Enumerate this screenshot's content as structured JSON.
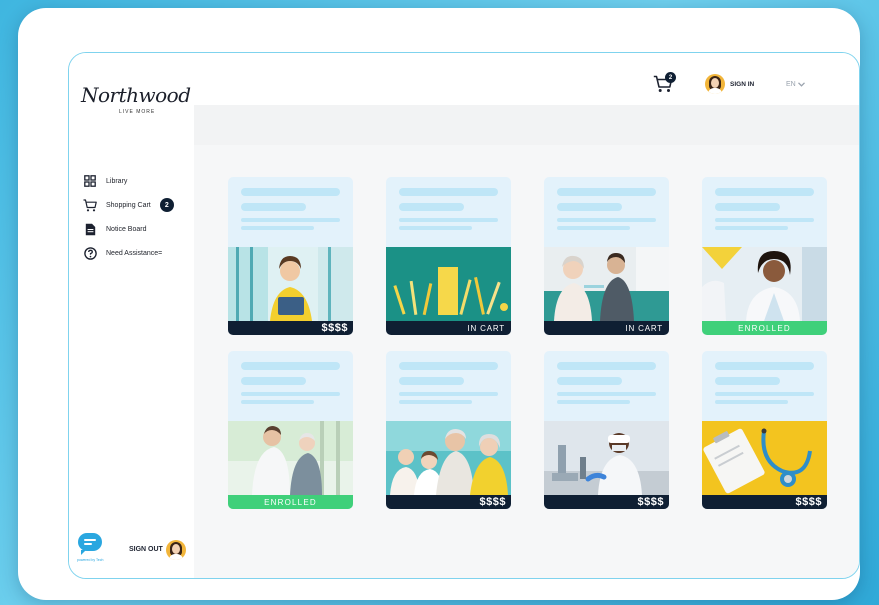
{
  "app": {
    "logo_text": "Northwood",
    "tagline": "LIVE MORE"
  },
  "header": {
    "cart_count": "2",
    "signin_label": "SIGN IN",
    "language": "EN"
  },
  "sidebar": {
    "items": [
      {
        "label": "Library",
        "icon": "grid-icon"
      },
      {
        "label": "Shopping Cart",
        "icon": "cart-icon",
        "badge": "2"
      },
      {
        "label": "Notice Board",
        "icon": "document-icon"
      },
      {
        "label": "Need Assistance=",
        "icon": "help-icon"
      }
    ],
    "powered_by": "powered by Tech",
    "signout_label": "SIGN OUT"
  },
  "courses": [
    {
      "status": "$$$$",
      "status_type": "price",
      "image": "woman in yellow hoodie with tablet"
    },
    {
      "status": "IN CART",
      "status_type": "dark",
      "image": "school supplies on teal background"
    },
    {
      "status": "IN CART",
      "status_type": "dark",
      "image": "nurse vaccinating elderly woman"
    },
    {
      "status": "ENROLLED",
      "status_type": "green",
      "image": "smiling woman doctor in lab coat"
    },
    {
      "status": "ENROLLED",
      "status_type": "green",
      "image": "doctor helping elderly man walk"
    },
    {
      "status": "$$$$",
      "status_type": "price",
      "image": "grandparents with grandchildren"
    },
    {
      "status": "$$$$",
      "status_type": "price",
      "image": "scientist using microscope"
    },
    {
      "status": "$$$$",
      "status_type": "price",
      "image": "stethoscope and clipboard on yellow"
    }
  ],
  "colors": {
    "accent": "#2aa7e0",
    "navy": "#0f1f33",
    "enrolled_green": "#3fd07a",
    "skeleton": "#bfe6f7",
    "card_bg": "#e3f2fb"
  }
}
